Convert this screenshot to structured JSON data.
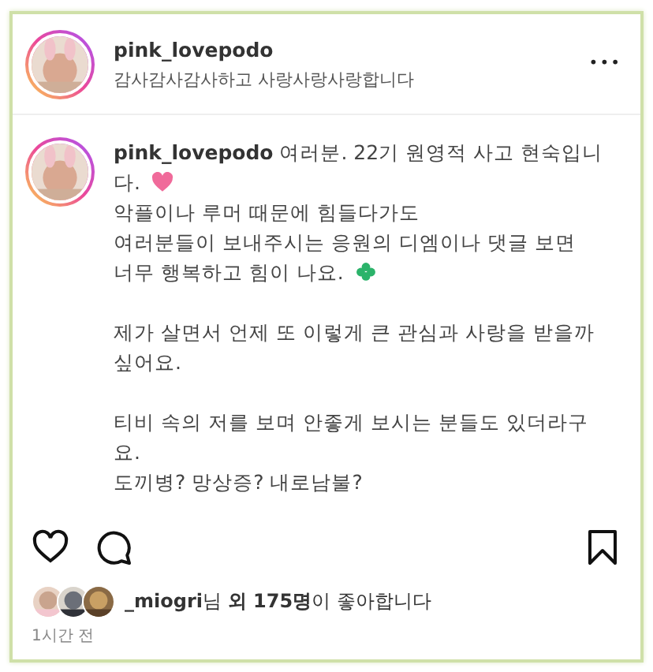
{
  "header": {
    "username": "pink_lovepodo",
    "subtitle": "감사감사감사하고 사랑사랑사랑합니다",
    "more": "•••"
  },
  "post": {
    "avatar": {
      "kind": "picture"
    },
    "username": "pink_lovepodo",
    "paragraphs": [
      [
        {
          "text": "여러분. 22기 원영적 사고 현숙입니다.",
          "kind": "heart"
        },
        {
          "text": "악플이나 루머 때문에 힘들다가도"
        },
        {
          "text": "여러분들이 보내주시는 응원의 디엠이나 댓글 보면"
        },
        {
          "text": "너무 행복하고 힘이 나요.",
          "kind": "clover"
        }
      ],
      [
        {
          "text": "제가 살면서 언제 또 이렇게 큰 관심과 사랑을 받을까 싶어요."
        }
      ],
      [
        {
          "text": "티비 속의 저를 보며 안좋게 보시는 분들도 있더라구요."
        },
        {
          "text": "도끼병? 망상증? 내로남불?"
        }
      ]
    ]
  },
  "actions": {
    "liked": false,
    "saved": false
  },
  "likes": {
    "avatars": [
      {
        "kind": "picture"
      },
      {
        "kind": "picture"
      },
      {
        "kind": "picture"
      }
    ],
    "text": "**_miogri**님 **외 175명**이 좋아합니다"
  },
  "time": "1시간 전"
}
